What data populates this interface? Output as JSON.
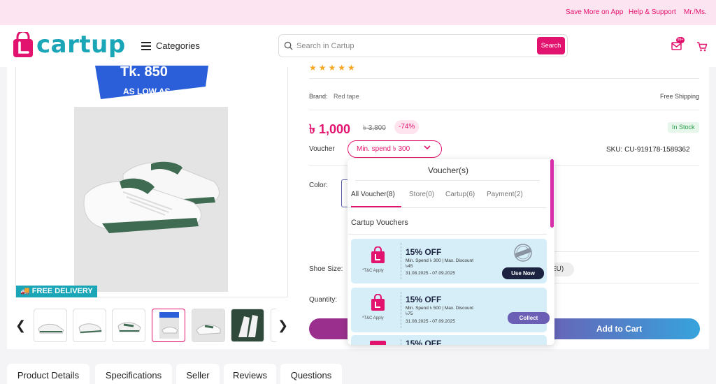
{
  "topbar": {
    "links": [
      "Save More on App",
      "Help & Support",
      "Mr./Ms."
    ]
  },
  "header": {
    "logo": "cartup",
    "categories": "Categories",
    "search_placeholder": "Search in Cartup",
    "search_button": "Search",
    "mail_badge": "99+"
  },
  "gallery": {
    "promo_price": "Tk. 850",
    "promo_sub": "AS LOW AS",
    "free_delivery": "FREE DELIVERY",
    "thumb_count": 6,
    "active_thumb": 4
  },
  "product": {
    "rating_stars": "★★★★★",
    "brand_label": "Brand:",
    "brand": "Red tape",
    "free_shipping": "Free Shipping",
    "price": "৳ 1,000",
    "old_price": "৳ 3,800",
    "discount": "-74%",
    "stock": "In Stock",
    "voucher_label": "Voucher",
    "voucher_pill": "Min. spend ৳ 300",
    "sku": "SKU: CU-919178-1589362",
    "color_label": "Color:",
    "shoe_size_label": "Shoe Size:",
    "size_chip": "EU)",
    "quantity_label": "Quantity:",
    "add_to_cart": "Add to Cart"
  },
  "voucher_panel": {
    "title": "Voucher(s)",
    "tabs": [
      "All Voucher(8)",
      "Store(0)",
      "Cartup(6)",
      "Payment(2)"
    ],
    "active_tab": 0,
    "section": "Cartup Vouchers",
    "cards": [
      {
        "tc": "*T&C Apply",
        "off": "15% OFF",
        "min_line1": "Min. Spend ৳ 300 | Max. Discount",
        "min_line2": "৳45",
        "date": "31.08.2025 - 07.09.2025",
        "button": "Use Now",
        "collected": true
      },
      {
        "tc": "*T&C Apply",
        "off": "15% OFF",
        "min_line1": "Min. Spend ৳ 500 | Max. Discount",
        "min_line2": "৳75",
        "date": "31.08.2025 - 07.09.2025",
        "button": "Collect",
        "collected": false
      },
      {
        "off": "15% OFF"
      }
    ],
    "colors": {
      "use_now": "#1c2340",
      "collect": "#6b5fb5"
    }
  },
  "bottom_tabs": [
    "Product Details",
    "Specifications",
    "Seller",
    "Reviews",
    "Questions"
  ],
  "colors": {
    "brand_pink": "#e2136e",
    "brand_teal": "#1aa6b7"
  }
}
